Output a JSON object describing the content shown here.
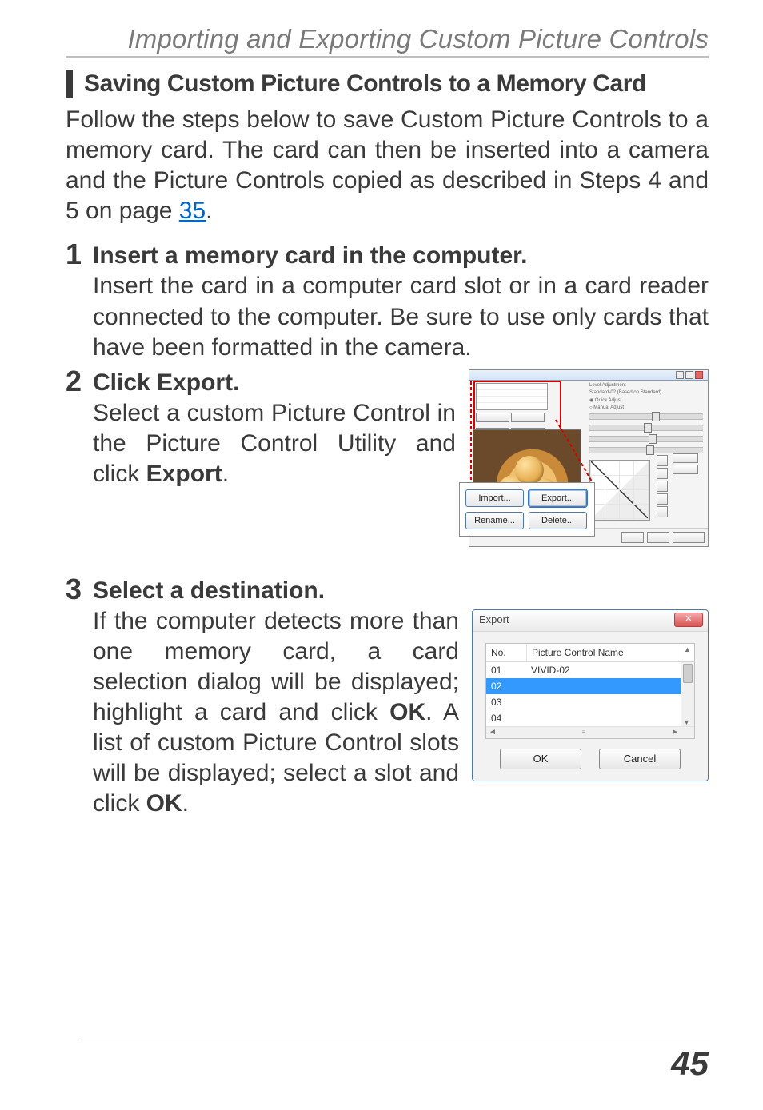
{
  "header": {
    "title": "Importing and Exporting Custom Picture Controls"
  },
  "section": {
    "title": "Saving Custom Picture Controls to a Memory Card"
  },
  "intro": {
    "pre_link": "Follow the steps below to save Custom Picture Controls to a memory card.  The card can then be inserted into a camera and the Picture Controls copied as described in Steps 4 and 5 on page ",
    "link": "35",
    "post_link": "."
  },
  "steps": {
    "s1": {
      "num": "1",
      "title": "Insert a memory card in the computer.",
      "body": "Insert the card in a computer card slot or in a card reader connected to the computer.  Be sure to use only cards that have been formatted in the camera."
    },
    "s2": {
      "num": "2",
      "title_pre": "Click ",
      "title_kw": "Export",
      "title_post": ".",
      "body_pre": "Select a custom Picture Control in the Picture Control Utility and click ",
      "body_bold": "Export",
      "body_post": "."
    },
    "s3": {
      "num": "3",
      "title": "Select a destination.",
      "body_1": "If the computer detects more than one memory card, a card selection dialog will be displayed; highlight a card and click ",
      "body_bold1": "OK",
      "body_2": ".  A list of custom Picture Control slots will be displayed; select a slot and click ",
      "body_bold2": "OK",
      "body_3": "."
    }
  },
  "callout": {
    "import": "Import...",
    "export": "Export...",
    "rename": "Rename...",
    "delete": "Delete..."
  },
  "dialog": {
    "title": "Export",
    "close": "✕",
    "col_no": "No.",
    "col_name": "Picture Control Name",
    "rows": {
      "r1_no": "01",
      "r1_name": "VIVID-02",
      "r2_no": "02",
      "r3_no": "03",
      "r4_no": "04"
    },
    "ok": "OK",
    "cancel": "Cancel"
  },
  "page_number": "45"
}
